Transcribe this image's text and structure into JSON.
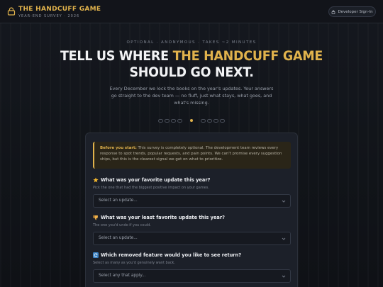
{
  "header": {
    "title": "THE HANDCUFF GAME",
    "subtitle": "YEAR-END SURVEY · 2026",
    "signin_label": "Developer Sign-In",
    "brand_icon": "lock-icon",
    "signin_icon": "lock-icon"
  },
  "hero": {
    "eyebrow": "OPTIONAL · ANONYMOUS · TAKES ~2 MINUTES",
    "headline_pre": "TELL US WHERE ",
    "headline_accent": "THE HANDCUFF GAME",
    "headline_post": "SHOULD GO NEXT.",
    "intro": "Every December we lock the books on the year's updates. Your answers go straight to the dev team — no fluff, just what stays, what goes, and what's missing."
  },
  "notice": {
    "lead": "Before you start:",
    "body": " This survey is completely optional. The development team reviews every response to spot trends, popular requests, and pain points. We can't promise every suggestion ships, but this is the clearest signal we get on what to prioritize."
  },
  "questions": [
    {
      "icon": "star-icon",
      "label": "What was your favorite update this year?",
      "help": "Pick the one that had the biggest positive impact on your games.",
      "placeholder": "Select an update..."
    },
    {
      "icon": "thumbs-down-icon",
      "label": "What was your least favorite update this year?",
      "help": "The one you'd undo if you could.",
      "placeholder": "Select an update..."
    },
    {
      "icon": "refresh-icon",
      "label": "Which removed feature would you like to see return?",
      "help": "Select as many as you'd genuinely want back.",
      "placeholder": "Select any that apply..."
    }
  ],
  "colors": {
    "accent": "#e0b24c",
    "background": "#111419",
    "card": "#1c2029"
  }
}
